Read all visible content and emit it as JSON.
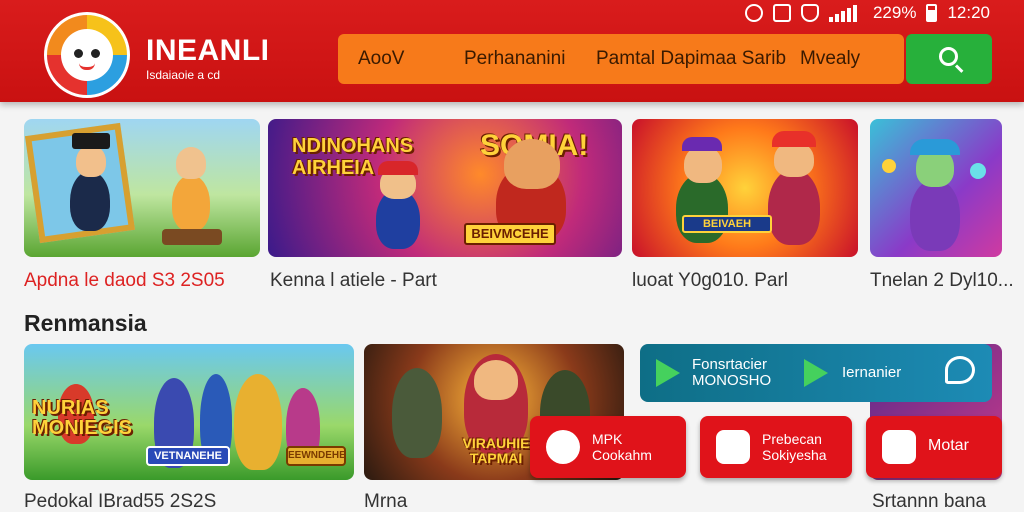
{
  "status_bar": {
    "battery": "229%",
    "time": "12:20"
  },
  "brand": {
    "name": "INEANLI",
    "tagline": "Isdaiaoie a cd"
  },
  "nav": {
    "items": [
      "AooV",
      "Perhananini",
      "Pamtal Dapimaa Sarib",
      "Mvealy"
    ]
  },
  "top_row": [
    {
      "caption": "Apdna le daod S3 2S05",
      "highlight": true
    },
    {
      "caption": "Kenna l atiele - Part",
      "banner": "NDINOHANS AIRHEIA",
      "banner2": "SOMIA!",
      "sign": "BEIVMCEHE"
    },
    {
      "caption": "luoat Y0g010. Parl",
      "sign": "BEIVAEH"
    },
    {
      "caption": "Tnelan 2 Dyl10..."
    }
  ],
  "section": {
    "title": "Renmansia"
  },
  "bottom_row": [
    {
      "caption": "Pedokal IBrad55 2S2S",
      "banner": "NURIAS MONIEGIS",
      "tag1": "VETNANEHE",
      "tag2": "EEWNDEHE"
    },
    {
      "caption": "Mrna",
      "banner": "VIRAUHIE TAPMAI"
    },
    {
      "caption": "Srtannn bana"
    }
  ],
  "store_bar": {
    "left_label": "Fonsrtacier MONOSHO",
    "right_label": "Iernanier"
  },
  "action_buttons": [
    {
      "label": "MPK Cookahm"
    },
    {
      "label": "Prebecan Sokiyesha"
    },
    {
      "label": "Motar"
    }
  ],
  "colors": {
    "header_red": "#d91c1c",
    "nav_orange": "#f77a1a",
    "search_green": "#27b03b",
    "button_red": "#e0131a"
  }
}
